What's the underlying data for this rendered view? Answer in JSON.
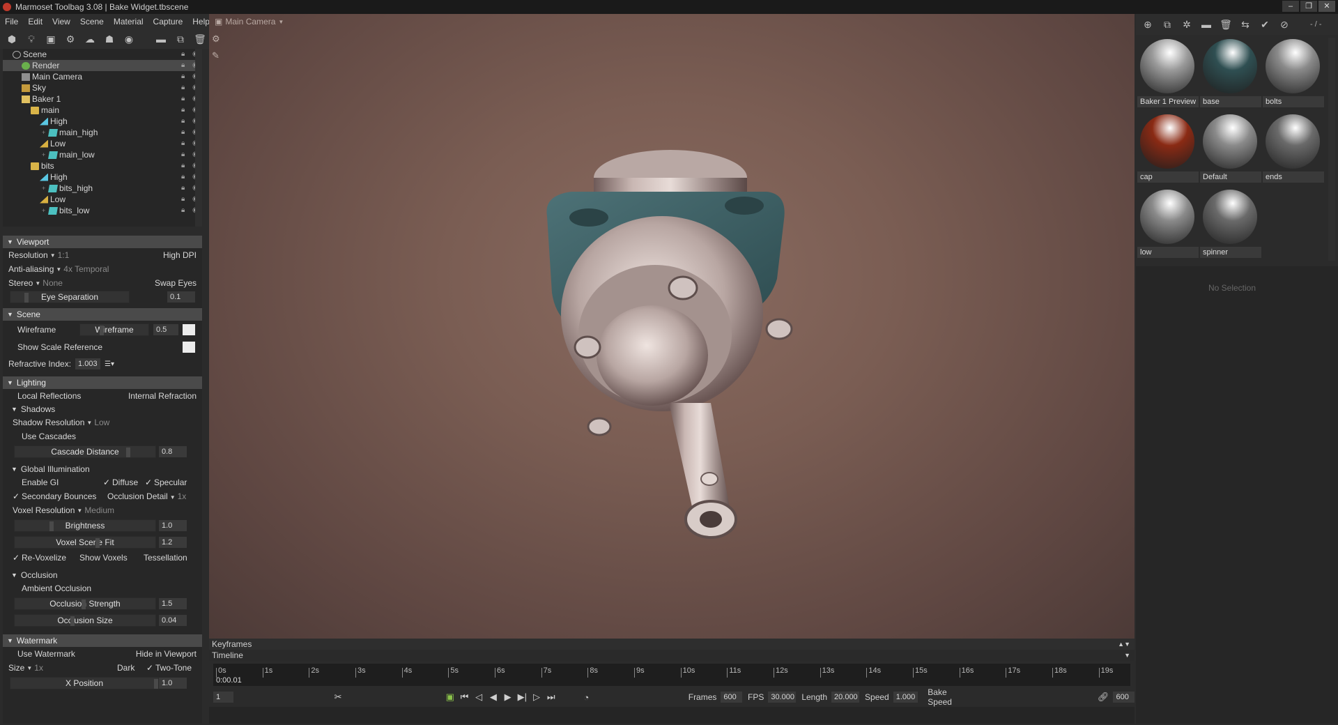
{
  "window": {
    "title": "Marmoset Toolbag 3.08  |  Bake Widget.tbscene"
  },
  "menu": [
    "File",
    "Edit",
    "View",
    "Scene",
    "Material",
    "Capture",
    "Help"
  ],
  "scene_tree": [
    {
      "label": "Scene",
      "depth": 0,
      "icon": "scene"
    },
    {
      "label": "Render",
      "depth": 1,
      "icon": "render",
      "selected": true
    },
    {
      "label": "Main Camera",
      "depth": 1,
      "icon": "cam"
    },
    {
      "label": "Sky",
      "depth": 1,
      "icon": "sky"
    },
    {
      "label": "Baker 1",
      "depth": 1,
      "icon": "baker"
    },
    {
      "label": "main",
      "depth": 2,
      "icon": "folder"
    },
    {
      "label": "High",
      "depth": 3,
      "icon": "high"
    },
    {
      "label": "main_high",
      "depth": 4,
      "icon": "cube"
    },
    {
      "label": "Low",
      "depth": 3,
      "icon": "low"
    },
    {
      "label": "main_low",
      "depth": 4,
      "icon": "cube"
    },
    {
      "label": "bits",
      "depth": 2,
      "icon": "folder"
    },
    {
      "label": "High",
      "depth": 3,
      "icon": "high"
    },
    {
      "label": "bits_high",
      "depth": 4,
      "icon": "cube"
    },
    {
      "label": "Low",
      "depth": 3,
      "icon": "low"
    },
    {
      "label": "bits_low",
      "depth": 4,
      "icon": "cube"
    }
  ],
  "viewport_section": {
    "title": "Viewport",
    "resolution_label": "Resolution",
    "resolution_value": "1:1",
    "high_dpi": "High DPI",
    "aa_label": "Anti-aliasing",
    "aa_value": "4x Temporal",
    "stereo_label": "Stereo",
    "stereo_value": "None",
    "swap_eyes": "Swap Eyes",
    "eye_sep_label": "Eye Separation",
    "eye_sep_value": "0.1"
  },
  "scene_section": {
    "title": "Scene",
    "wireframe": "Wireframe",
    "wireframe_slider": "Wireframe",
    "wireframe_value": "0.5",
    "scale_ref": "Show Scale Reference",
    "refr_label": "Refractive Index:",
    "refr_value": "1.003"
  },
  "lighting_section": {
    "title": "Lighting",
    "local_refl": "Local Reflections",
    "internal_refr": "Internal Refraction",
    "shadows": "Shadows",
    "shadow_res_label": "Shadow Resolution",
    "shadow_res_value": "Low",
    "use_cascades": "Use Cascades",
    "cascade_label": "Cascade Distance",
    "cascade_value": "0.8",
    "gi": "Global Illumination",
    "enable_gi": "Enable GI",
    "diffuse": "Diffuse",
    "specular": "Specular",
    "secondary": "Secondary Bounces",
    "occ_detail_label": "Occlusion Detail",
    "occ_detail_value": "1x",
    "voxel_res_label": "Voxel Resolution",
    "voxel_res_value": "Medium",
    "brightness_label": "Brightness",
    "brightness_value": "1.0",
    "voxel_fit_label": "Voxel Scene Fit",
    "voxel_fit_value": "1.2",
    "revoxelize": "Re-Voxelize",
    "show_voxels": "Show Voxels",
    "tessellation": "Tessellation",
    "occlusion": "Occlusion",
    "ambient_occ": "Ambient Occlusion",
    "occ_strength_label": "Occlusion Strength",
    "occ_strength_value": "1.5",
    "occ_size_label": "Occlusion Size",
    "occ_size_value": "0.04"
  },
  "watermark_section": {
    "title": "Watermark",
    "use_watermark": "Use Watermark",
    "hide_viewport": "Hide in Viewport",
    "size_label": "Size",
    "size_value": "1x",
    "dark": "Dark",
    "two_tone": "Two-Tone",
    "xpos_label": "X Position",
    "xpos_value": "1.0"
  },
  "viewport": {
    "camera": "Main Camera"
  },
  "timeline": {
    "keyframes": "Keyframes",
    "timeline": "Timeline",
    "ticks": [
      "0s",
      "1s",
      "2s",
      "3s",
      "4s",
      "5s",
      "6s",
      "7s",
      "8s",
      "9s",
      "10s",
      "11s",
      "12s",
      "13s",
      "14s",
      "15s",
      "16s",
      "17s",
      "18s",
      "19s"
    ],
    "current_time": "0:00.01",
    "frame_field": "1",
    "frames_label": "Frames",
    "frames_value": "600",
    "fps_label": "FPS",
    "fps_value": "30.000",
    "length_label": "Length",
    "length_value": "20.000",
    "speed_label": "Speed",
    "speed_value": "1.000",
    "bake_speed": "Bake Speed",
    "end_value": "600"
  },
  "materials": [
    {
      "name": "Baker 1 Preview",
      "color": "#9a9a9a"
    },
    {
      "name": "base",
      "color": "#2f4f52"
    },
    {
      "name": "bolts",
      "color": "#8a8a8a"
    },
    {
      "name": "cap",
      "color": "#8a2a14"
    },
    {
      "name": "Default",
      "color": "#8a8a8a"
    },
    {
      "name": "ends",
      "color": "#6a6a6a"
    },
    {
      "name": "low",
      "color": "#8a8a8a"
    },
    {
      "name": "spinner",
      "color": "#6a6a6a"
    }
  ],
  "right_panel": {
    "no_selection": "No Selection",
    "page_indicator": "- / -"
  }
}
